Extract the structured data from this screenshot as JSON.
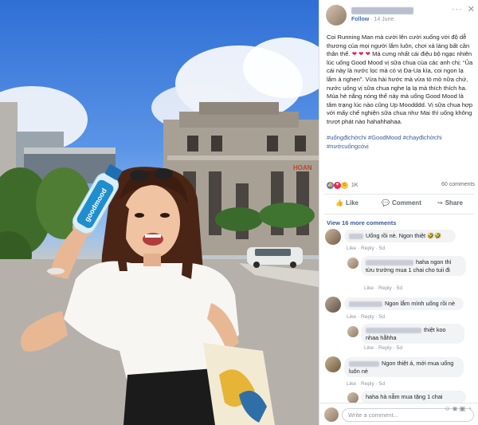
{
  "post": {
    "date": "14 June",
    "follow_label": "Follow",
    "separator": "·",
    "menu_icon": "ellipsis-icon",
    "close_icon": "close-icon",
    "caption_p1": "Coi Running Man mà cười lên cười xuống với độ dễ thương của mọi người lắm luôn, chơi xả láng bất cần thân thể.",
    "caption_hearts": "❤ ❤ ❤",
    "caption_p2": " Mà cưng nhất cái điệu bộ ngạc nhiên lúc uống Good Mood vị sữa chua của các anh chị: “Ủa cái này là nước lọc mà có vị Da-Ua kìa, coi ngon lạ lắm à nghen”. Vừa hài hước mà vừa tò mò nữa chứ, nước uống vị sữa chua nghe lạ lạ mà thích thích ha.",
    "caption_p3": "Mùa hè nắng nóng thế này mà uống Good Mood là tâm trạng lúc nào cũng Up Moodddd. Vị sữa chua hợp với mấy chế nghiện sữa chua như Mai thì uống không trượt phát nào hahahhahaa.",
    "hashtags": "#uốngđichờchi #GoodMood #chayđichờchi #nướcuốngcóvị",
    "reaction_count": "1K",
    "comment_count": "60 comments",
    "actions": {
      "like": "Like",
      "comment": "Comment",
      "share": "Share"
    },
    "view_more": "View 16 more comments"
  },
  "comments": [
    {
      "text": "Uống rồi nè. Ngon thiệt 🤣🤣",
      "meta": "Like · Reply · 5d"
    },
    {
      "text": "haha ngon thì từu trường mua 1 chai cho tuii đi",
      "meta": "Like · Reply · 5d"
    },
    {
      "text": "Ngon lắm mình uống rồi nè",
      "meta": "Like · Reply · 5d"
    },
    {
      "text": "thiệt koo nhaa hằhha",
      "meta": "Like · Reply · 5d"
    },
    {
      "text": "Ngon thiệt á, mới mua uống luôn nè",
      "meta": "Like · Reply · 5d"
    },
    {
      "text": "haha hà nẵm mua tặng 1 chai",
      "meta": ""
    }
  ],
  "composer": {
    "placeholder": "Write a comment..."
  },
  "photo": {
    "bottle_brand": "goodmood",
    "building_sign": "HOAN"
  },
  "colors": {
    "link": "#385898",
    "accent": "#4267b2",
    "heart": "#e0245e"
  }
}
